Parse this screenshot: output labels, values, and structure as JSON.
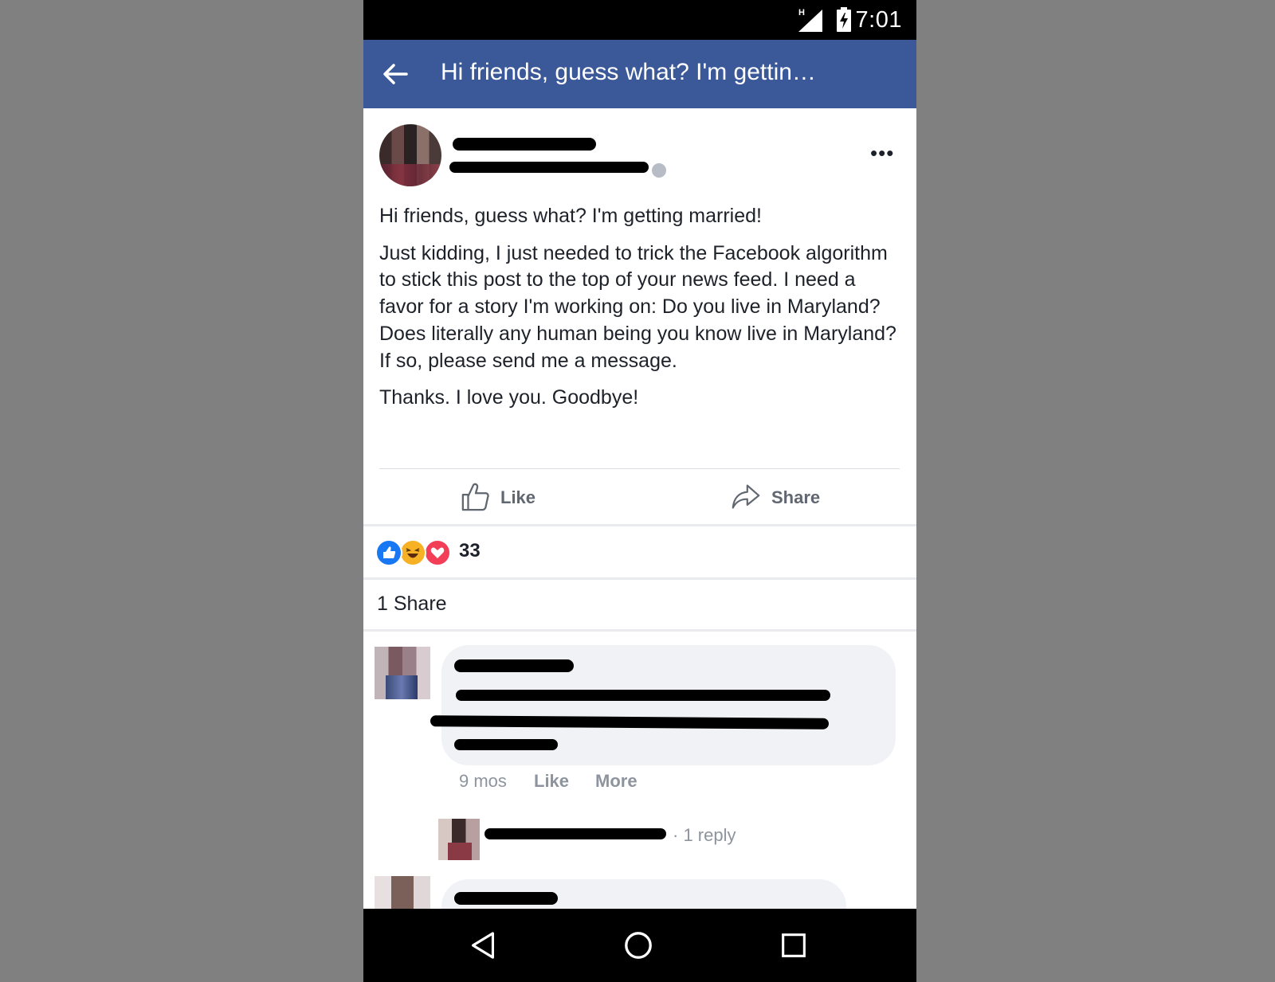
{
  "status_bar": {
    "network": "H",
    "time": "7:01",
    "icons": [
      "signal-icon",
      "battery-charging-icon"
    ]
  },
  "app_bar": {
    "back_icon": "arrow-left-icon",
    "title": "Hi friends, guess what? I'm gettin…"
  },
  "post": {
    "author_name": "[redacted]",
    "timestamp": "[redacted]",
    "privacy_icon": "globe-icon",
    "more_icon": "more-options-icon",
    "more_label": "•••",
    "paragraphs": [
      "Hi friends, guess what? I'm getting married!",
      "Just kidding, I just needed to trick the Facebook algorithm to stick this post to the top of your news feed. I need a favor for a story I'm working on: Do you live in Maryland? Does literally any human being you know live in Maryland? If so, please send me a message.",
      "Thanks. I love you. Goodbye!"
    ],
    "actions": {
      "like_label": "Like",
      "share_label": "Share"
    },
    "reactions": {
      "icons": [
        "like-reaction-icon",
        "haha-reaction-icon",
        "love-reaction-icon"
      ],
      "count": "33"
    },
    "shares": "1 Share",
    "colors": {
      "brand": "#3b5998",
      "like_blue": "#1877f2",
      "love_red": "#f33e58",
      "haha_yellow": "#f7b125"
    }
  },
  "comments": [
    {
      "author": "[redacted]",
      "text": "[redacted]",
      "age": "9 mos",
      "like_label": "Like",
      "more_label": "More",
      "reply_summary": {
        "author": "[redacted]",
        "separator": "·",
        "count_label": "1 reply"
      }
    },
    {
      "author": "[redacted]"
    }
  ],
  "nav_bar": {
    "icons": [
      "back-triangle-icon",
      "home-circle-icon",
      "recents-square-icon"
    ]
  }
}
